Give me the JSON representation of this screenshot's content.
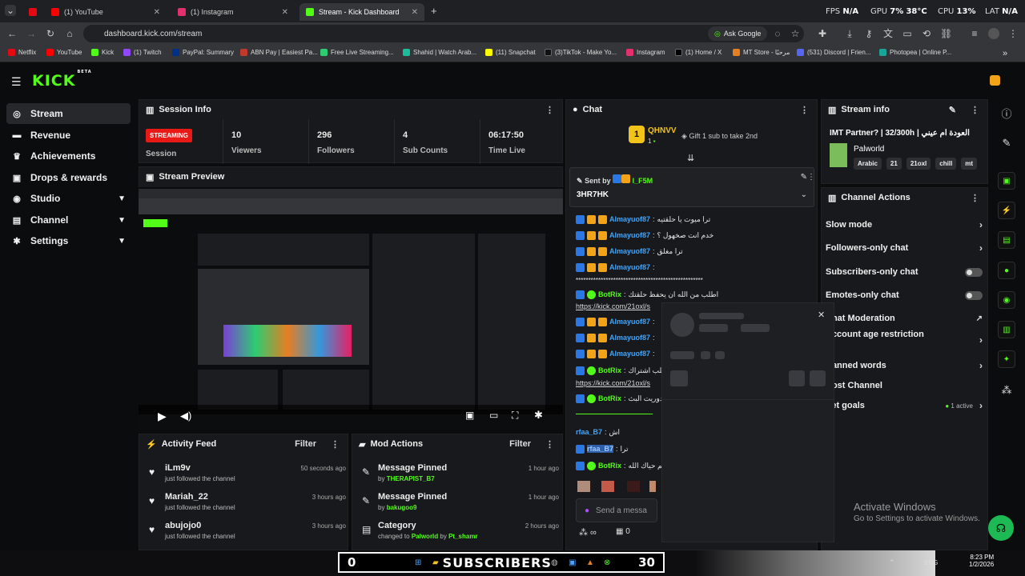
{
  "browser": {
    "tabs": [
      {
        "label": "(1) YouTube",
        "color": "#ff0000"
      },
      {
        "label": "(1) Instagram",
        "color": "#e1306c"
      },
      {
        "label": "Stream - Kick Dashboard",
        "color": "#53fc18"
      }
    ],
    "new_tab": "+",
    "perf": {
      "fps_label": "FPS",
      "fps": "N/A",
      "gpu_label": "GPU",
      "gpu": "7%",
      "gpu_temp": "38°C",
      "cpu_label": "CPU",
      "cpu": "13%",
      "lat_label": "LAT",
      "lat": "N/A"
    },
    "url": "dashboard.kick.com/stream",
    "ask_google": "Ask Google",
    "bookmarks": [
      {
        "label": "Netflix",
        "color": "#e50914"
      },
      {
        "label": "YouTube",
        "color": "#ff0000"
      },
      {
        "label": "Kick",
        "color": "#53fc18"
      },
      {
        "label": "(1) Twitch",
        "color": "#9146ff"
      },
      {
        "label": "PayPal: Summary",
        "color": "#003087"
      },
      {
        "label": "ABN Pay | Easiest Pa...",
        "color": "#c0392b"
      },
      {
        "label": "Free Live Streaming...",
        "color": "#2ecc71"
      },
      {
        "label": "Shahid | Watch Arab...",
        "color": "#1abc9c"
      },
      {
        "label": "(11) Snapchat",
        "color": "#fffc00"
      },
      {
        "label": "(3)TikTok - Make Yo...",
        "color": "#111111"
      },
      {
        "label": "Instagram",
        "color": "#e1306c"
      },
      {
        "label": "(1) Home / X",
        "color": "#000000"
      },
      {
        "label": "MT Store - مرحبًا",
        "color": "#e67e22"
      },
      {
        "label": "(531) Discord | Frien...",
        "color": "#5865f2"
      },
      {
        "label": "Photopea | Online P...",
        "color": "#18a497"
      }
    ]
  },
  "kick": {
    "logo": "KICK",
    "logo_sup": "BETA",
    "sidebar": [
      {
        "label": "Stream",
        "icon": "stream-icon",
        "glyph": "((·))"
      },
      {
        "label": "Revenue",
        "icon": "revenue-icon",
        "glyph": "▬"
      },
      {
        "label": "Achievements",
        "icon": "trophy-icon",
        "glyph": "♛"
      },
      {
        "label": "Drops & rewards",
        "icon": "gift-icon",
        "glyph": "▣"
      },
      {
        "label": "Studio",
        "icon": "studio-icon",
        "glyph": "◉"
      },
      {
        "label": "Channel",
        "icon": "channel-icon",
        "glyph": "▤"
      },
      {
        "label": "Settings",
        "icon": "gear-icon",
        "glyph": "✱"
      }
    ],
    "session": {
      "title": "Session Info",
      "badge": "STREAMING",
      "badge_label": "Session",
      "stats": [
        {
          "value": "10",
          "label": "Viewers"
        },
        {
          "value": "296",
          "label": "Followers"
        },
        {
          "value": "4",
          "label": "Sub Counts"
        },
        {
          "value": "06:17:50",
          "label": "Time Live"
        }
      ]
    },
    "preview": {
      "title": "Stream Preview"
    },
    "activity": {
      "title": "Activity Feed",
      "filter": "Filter",
      "items": [
        {
          "name": "iLm9v",
          "text": "just followed the channel",
          "ago": "50 seconds ago"
        },
        {
          "name": "Mariah_22",
          "text": "just followed the channel",
          "ago": "3 hours ago"
        },
        {
          "name": "abujojo0",
          "text": "just followed the channel",
          "ago": "3 hours ago"
        }
      ]
    },
    "mod": {
      "title": "Mod Actions",
      "filter": "Filter",
      "items": [
        {
          "title": "Message Pinned",
          "prefix": "by",
          "user": "THERAPIST_B7",
          "ago": "1 hour ago"
        },
        {
          "title": "Message Pinned",
          "prefix": "by",
          "user": "bakugoo9",
          "ago": "1 hour ago"
        },
        {
          "title": "Category",
          "prefix": "changed to",
          "user": "Palworld",
          "mid": "by",
          "user2": "Pt_shamr",
          "ago": "2 hours ago"
        }
      ]
    },
    "chat": {
      "title": "Chat",
      "top_gifter": "QHNVV",
      "top_gifter_rank": "1",
      "top_gifter_count": "1",
      "gift_cta": "Gift 1 sub to take 2nd",
      "pinned": {
        "sent_by": "Sent by",
        "user": "I_F5M",
        "text": "3HR7HK"
      },
      "messages": [
        {
          "user": "Almayuof87",
          "text": "ترا ميوت يا حلقتيه"
        },
        {
          "user": "Almayuof87",
          "text": "خدم انت صخهول ؟"
        },
        {
          "user": "Almayuof87",
          "text": "ترا مغلق"
        },
        {
          "user": "Almayuof87",
          "text": ""
        },
        {
          "user": "",
          "text": "***************************************************"
        },
        {
          "user": "BotRix",
          "text": "اطلب من الله ان يحفظ حلقتك",
          "link": "https://kick.com/21oxl/s"
        },
        {
          "user": "Almayuof87",
          "text": ""
        },
        {
          "user": "Almayuof87",
          "text": ""
        },
        {
          "user": "Almayuof87",
          "text": ""
        },
        {
          "user": "BotRix",
          "text": "حلب اشتراك",
          "link": "https://kick.com/21oxl/s"
        },
        {
          "user": "BotRix",
          "text": "دوريت البث"
        },
        {
          "user": "rfaa_B7",
          "text": "اش"
        },
        {
          "user": "rfaa_B7",
          "text": "ترا"
        },
        {
          "user": "BotRix",
          "text": "لكم حياك الله"
        }
      ],
      "send_placeholder": "Send a messa",
      "footer_count": "0"
    },
    "stream_info": {
      "title": "Stream info",
      "stream_title": "IMT Partner? | 32/300h | العودة ام عيني",
      "category": "Palworld",
      "tags": [
        "Arabic",
        "21",
        "21oxl",
        "chill",
        "mt"
      ]
    },
    "channel_actions": {
      "title": "Channel Actions",
      "items": [
        {
          "label": "Slow mode",
          "control": "chevron"
        },
        {
          "label": "Followers-only chat",
          "control": "chevron"
        },
        {
          "label": "Subscribers-only chat",
          "control": "toggle"
        },
        {
          "label": "Emotes-only chat",
          "control": "toggle"
        },
        {
          "label": "Chat Moderation",
          "control": "external"
        },
        {
          "label": "Account age restriction",
          "control": "chevron"
        },
        {
          "label": "Banned words",
          "control": "chevron"
        },
        {
          "label": "Host Channel",
          "control": "none"
        },
        {
          "label": "Set goals",
          "control": "active",
          "extra": "1 active"
        }
      ]
    }
  },
  "overlay": {
    "left": "0",
    "text": "SUBSCRIBERS",
    "right": "30"
  },
  "windows": {
    "activate_title": "Activate Windows",
    "activate_sub": "Go to Settings to activate Windows.",
    "lang": "ENG",
    "time": "8:23 PM",
    "date": "1/2/2026"
  }
}
